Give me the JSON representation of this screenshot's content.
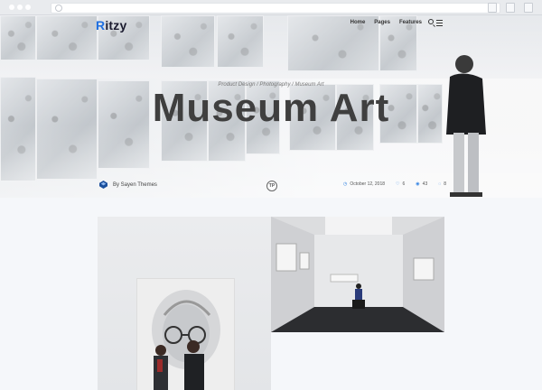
{
  "site": {
    "logo": "Ritzy",
    "logo_mark": "R",
    "logo_rest": "itzy"
  },
  "nav": {
    "items": [
      "Home",
      "Pages",
      "Features"
    ]
  },
  "hero": {
    "breadcrumbs": "Product Design / Photography / Museum Art",
    "title": "Museum Art",
    "author": "By Sayen Themes",
    "badge": "TP",
    "meta": {
      "date": "October 12, 2018",
      "likes": "6",
      "views": "43",
      "comments": "8"
    }
  },
  "colors": {
    "accent": "#2a7de1",
    "logo_accent": "#1f6fe0"
  },
  "icons": [
    "search-icon",
    "menu-icon",
    "calendar-icon",
    "heart-icon",
    "eye-icon",
    "comment-icon",
    "author-icon"
  ]
}
